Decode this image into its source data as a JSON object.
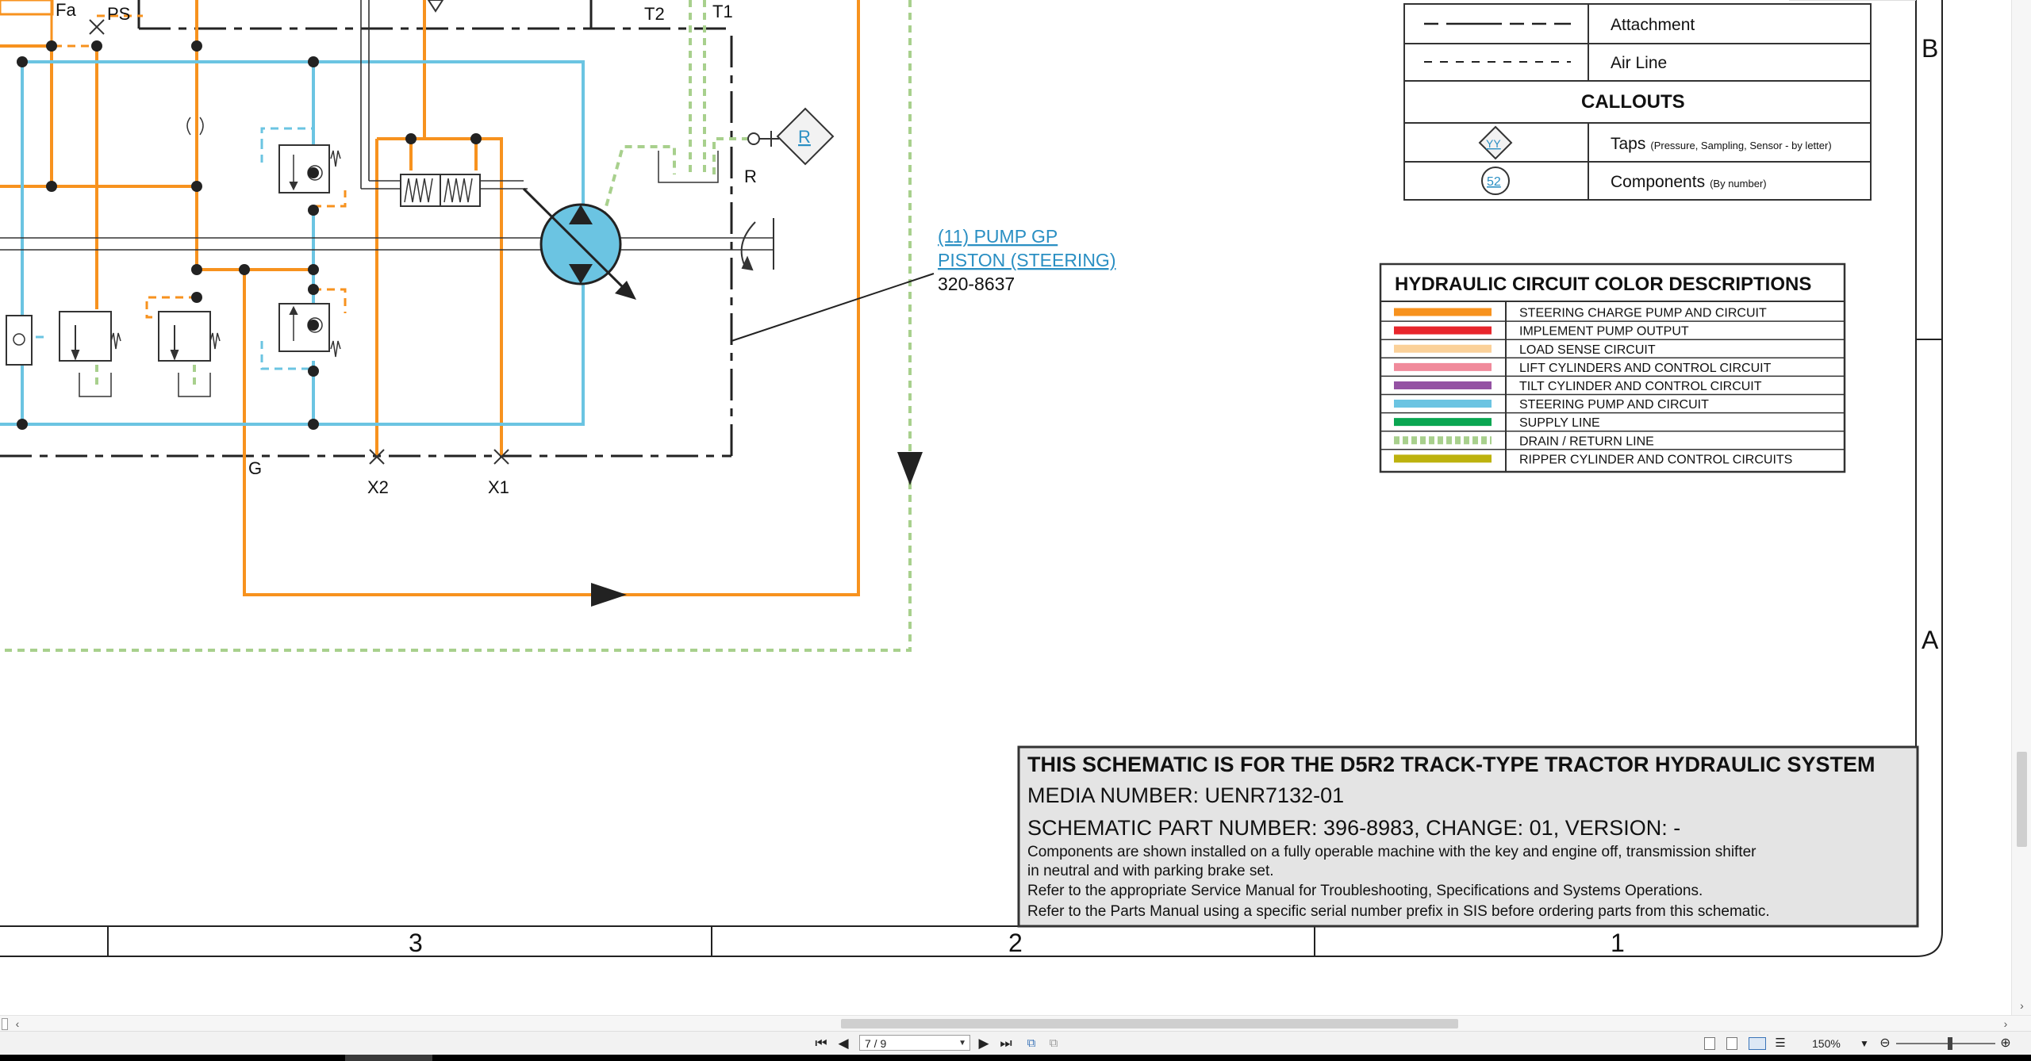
{
  "schematic": {
    "connection_labels": [
      "Fa",
      "PS",
      "T2",
      "T1",
      "R",
      "G",
      "X2",
      "X1"
    ],
    "callout_tap_letter": "R",
    "component_callout": {
      "line1": "(11) PUMP GP",
      "line2": "PISTON (STEERING)",
      "part_number": "320-8637"
    },
    "grid_letters": [
      "B",
      "A"
    ],
    "grid_numbers": [
      "3",
      "2",
      "1"
    ]
  },
  "legend": {
    "line_types": [
      "Attachment",
      "Air Line"
    ],
    "callouts_title": "CALLOUTS",
    "taps_symbol": "YY",
    "taps_label": "Taps",
    "taps_note": "(Pressure, Sampling, Sensor - by letter)",
    "components_symbol": "52",
    "components_label": "Components",
    "components_note": "(By number)"
  },
  "color_descriptions": {
    "title": "HYDRAULIC CIRCUIT COLOR DESCRIPTIONS",
    "items": [
      {
        "label": "STEERING CHARGE PUMP AND CIRCUIT",
        "color": "#f7921e"
      },
      {
        "label": "IMPLEMENT PUMP OUTPUT",
        "color": "#e8262c"
      },
      {
        "label": "LOAD SENSE CIRCUIT",
        "color": "#fbd199"
      },
      {
        "label": "LIFT CYLINDERS AND CONTROL CIRCUIT",
        "color": "#f08a9b"
      },
      {
        "label": "TILT CYLINDER AND CONTROL CIRCUIT",
        "color": "#9452a3"
      },
      {
        "label": "STEERING PUMP AND CIRCUIT",
        "color": "#6bc4e2"
      },
      {
        "label": "SUPPLY LINE",
        "color": "#0aa651"
      },
      {
        "label": "DRAIN / RETURN LINE",
        "color": "#a8d08d",
        "dashed": true
      },
      {
        "label": "RIPPER CYLINDER AND CONTROL CIRCUITS",
        "color": "#bdb20e"
      }
    ]
  },
  "title_block": {
    "headline": "THIS SCHEMATIC IS FOR THE D5R2 TRACK-TYPE TRACTOR HYDRAULIC SYSTEM",
    "media": "MEDIA NUMBER: UENR7132-01",
    "part": "SCHEMATIC PART NUMBER: 396-8983, CHANGE: 01, VERSION: -",
    "note1a": "Components are shown installed on a fully operable machine with the key and engine off, transmission shifter",
    "note1b": "in neutral and with parking brake set.",
    "note2": "Refer to the appropriate Service Manual for Troubleshooting, Specifications and Systems Operations.",
    "note3": "Refer to the Parts Manual using a specific serial number prefix in SIS before ordering parts from this schematic."
  },
  "viewer": {
    "page_indicator": "7 / 9",
    "zoom": "150%"
  },
  "colors": {
    "orange": "#f7921e",
    "blue": "#6bc4e2",
    "green_dash": "#a8d08d",
    "link": "#2a8fc3"
  }
}
